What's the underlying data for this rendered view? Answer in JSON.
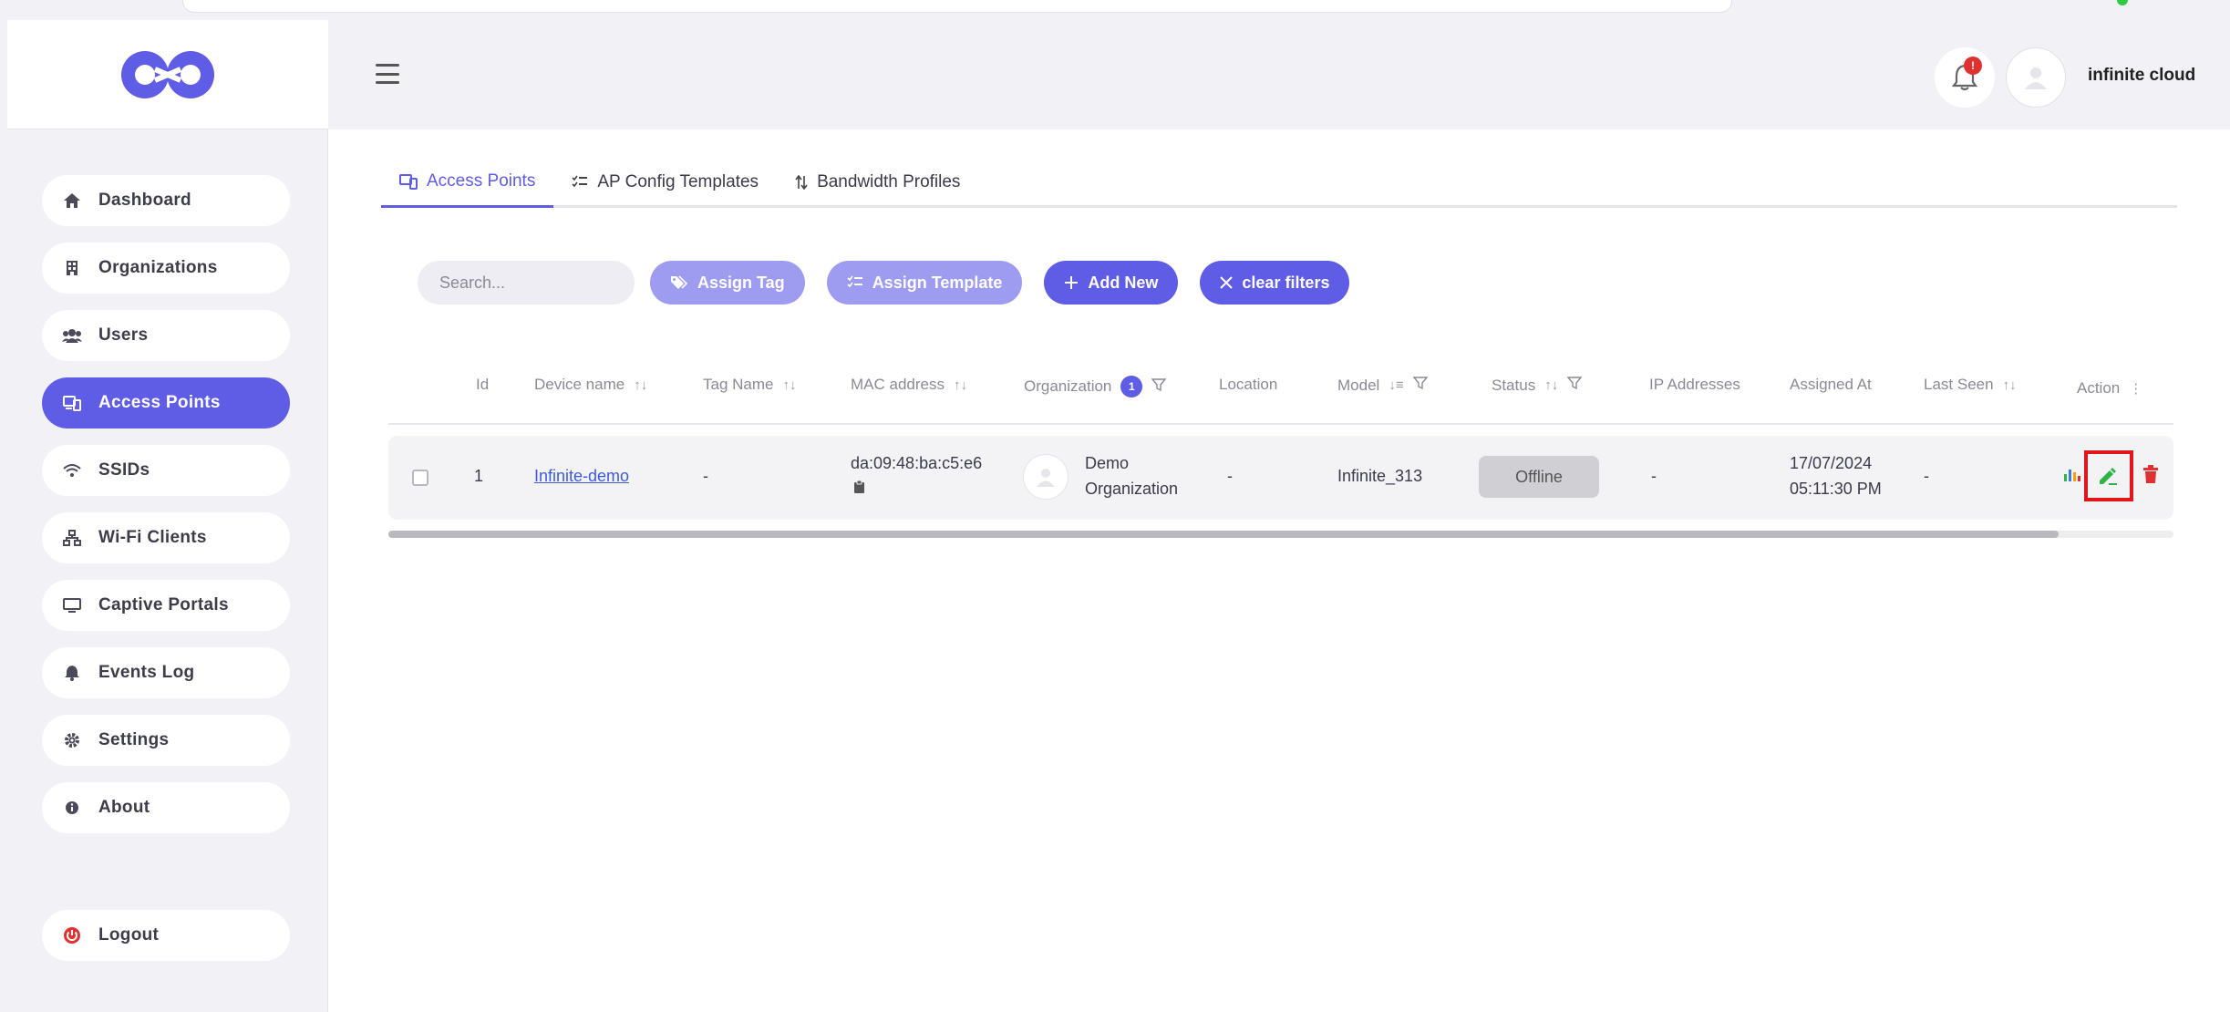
{
  "app": {
    "username": "infinite cloud",
    "notification_count": "!"
  },
  "sidebar": {
    "items": [
      {
        "label": "Dashboard",
        "icon": "home-icon"
      },
      {
        "label": "Organizations",
        "icon": "building-icon"
      },
      {
        "label": "Users",
        "icon": "users-icon"
      },
      {
        "label": "Access Points",
        "icon": "access-point-icon",
        "active": true
      },
      {
        "label": "SSIDs",
        "icon": "wifi-icon"
      },
      {
        "label": "Wi-Fi Clients",
        "icon": "network-icon"
      },
      {
        "label": "Captive Portals",
        "icon": "monitor-icon"
      },
      {
        "label": "Events Log",
        "icon": "bell-icon"
      },
      {
        "label": "Settings",
        "icon": "gear-icon"
      },
      {
        "label": "About",
        "icon": "info-icon"
      }
    ],
    "logout": "Logout"
  },
  "tabs": [
    {
      "label": "Access Points",
      "active": true
    },
    {
      "label": "AP Config Templates"
    },
    {
      "label": "Bandwidth Profiles"
    }
  ],
  "toolbar": {
    "search_placeholder": "Search...",
    "assign_tag": "Assign Tag",
    "assign_template": "Assign Template",
    "add_new": "Add New",
    "clear_filters": "clear filters"
  },
  "table": {
    "headers": {
      "id": "Id",
      "device_name": "Device name",
      "tag_name": "Tag Name",
      "mac": "MAC address",
      "organization": "Organization",
      "organization_filter_count": "1",
      "location": "Location",
      "model": "Model",
      "status": "Status",
      "ip": "IP Addresses",
      "assigned_at": "Assigned At",
      "last_seen": "Last Seen",
      "action": "Action"
    },
    "rows": [
      {
        "id": "1",
        "device_name": "Infinite-demo",
        "tag_name": "-",
        "mac": "da:09:48:ba:c5:e6",
        "organization_line1": "Demo",
        "organization_line2": "Organization",
        "location": "-",
        "model": "Infinite_313",
        "status": "Offline",
        "ip": "-",
        "assigned_date": "17/07/2024",
        "assigned_time": "05:11:30 PM",
        "last_seen": "-"
      }
    ]
  },
  "colors": {
    "accent": "#5f5ce6",
    "accent_light": "#9e9cf0",
    "danger": "#e03131",
    "edit": "#2fb344"
  }
}
